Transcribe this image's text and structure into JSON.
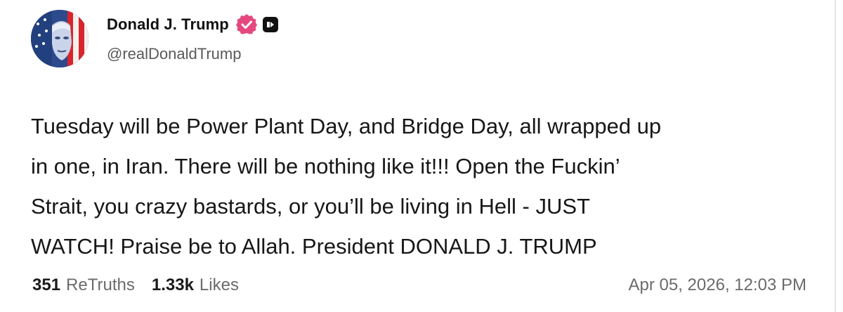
{
  "author": {
    "display_name": "Donald J. Trump",
    "handle": "@realDonaldTrump",
    "verified_badge_color": "#e5487e"
  },
  "post": {
    "lines": [
      "Tuesday will be Power Plant Day, and Bridge Day, all wrapped up",
      "in one, in Iran. There will be nothing like it!!! Open the Fuckin’",
      "Strait, you crazy bastards, or you’ll be living in Hell - JUST",
      "WATCH! Praise be to Allah. President DONALD J. TRUMP"
    ]
  },
  "stats": {
    "retruths_count": "351",
    "retruths_label": "ReTruths",
    "likes_count": "1.33k",
    "likes_label": "Likes"
  },
  "timestamp": "Apr 05, 2026, 12:03 PM"
}
